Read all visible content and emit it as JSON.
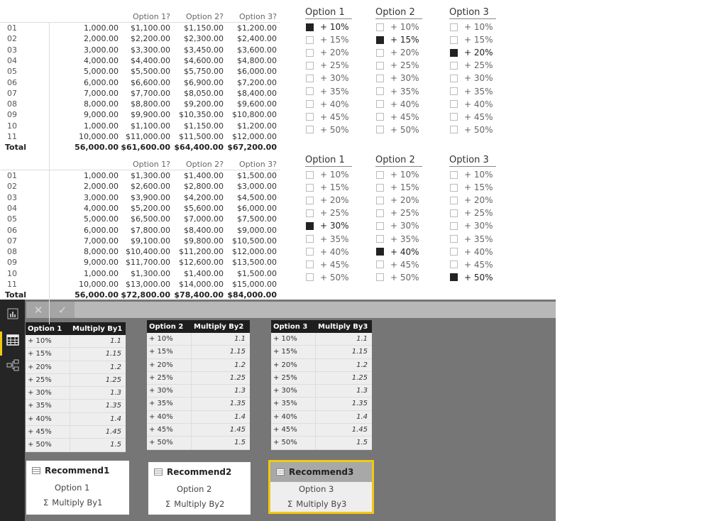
{
  "matrices": [
    {
      "headers": [
        "Option 1?",
        "Option 2?",
        "Option 3?"
      ],
      "rows": [
        [
          "01",
          "1,000.00",
          "$1,100.00",
          "$1,150.00",
          "$1,200.00"
        ],
        [
          "02",
          "2,000.00",
          "$2,200.00",
          "$2,300.00",
          "$2,400.00"
        ],
        [
          "03",
          "3,000.00",
          "$3,300.00",
          "$3,450.00",
          "$3,600.00"
        ],
        [
          "04",
          "4,000.00",
          "$4,400.00",
          "$4,600.00",
          "$4,800.00"
        ],
        [
          "05",
          "5,000.00",
          "$5,500.00",
          "$5,750.00",
          "$6,000.00"
        ],
        [
          "06",
          "6,000.00",
          "$6,600.00",
          "$6,900.00",
          "$7,200.00"
        ],
        [
          "07",
          "7,000.00",
          "$7,700.00",
          "$8,050.00",
          "$8,400.00"
        ],
        [
          "08",
          "8,000.00",
          "$8,800.00",
          "$9,200.00",
          "$9,600.00"
        ],
        [
          "09",
          "9,000.00",
          "$9,900.00",
          "$10,350.00",
          "$10,800.00"
        ],
        [
          "10",
          "1,000.00",
          "$1,100.00",
          "$1,150.00",
          "$1,200.00"
        ],
        [
          "11",
          "10,000.00",
          "$11,000.00",
          "$11,500.00",
          "$12,000.00"
        ]
      ],
      "total": [
        "Total",
        "56,000.00",
        "$61,600.00",
        "$64,400.00",
        "$67,200.00"
      ]
    },
    {
      "headers": [
        "Option 1?",
        "Option 2?",
        "Option 3?"
      ],
      "rows": [
        [
          "01",
          "1,000.00",
          "$1,300.00",
          "$1,400.00",
          "$1,500.00"
        ],
        [
          "02",
          "2,000.00",
          "$2,600.00",
          "$2,800.00",
          "$3,000.00"
        ],
        [
          "03",
          "3,000.00",
          "$3,900.00",
          "$4,200.00",
          "$4,500.00"
        ],
        [
          "04",
          "4,000.00",
          "$5,200.00",
          "$5,600.00",
          "$6,000.00"
        ],
        [
          "05",
          "5,000.00",
          "$6,500.00",
          "$7,000.00",
          "$7,500.00"
        ],
        [
          "06",
          "6,000.00",
          "$7,800.00",
          "$8,400.00",
          "$9,000.00"
        ],
        [
          "07",
          "7,000.00",
          "$9,100.00",
          "$9,800.00",
          "$10,500.00"
        ],
        [
          "08",
          "8,000.00",
          "$10,400.00",
          "$11,200.00",
          "$12,000.00"
        ],
        [
          "09",
          "9,000.00",
          "$11,700.00",
          "$12,600.00",
          "$13,500.00"
        ],
        [
          "10",
          "1,000.00",
          "$1,300.00",
          "$1,400.00",
          "$1,500.00"
        ],
        [
          "11",
          "10,000.00",
          "$13,000.00",
          "$14,000.00",
          "$15,000.00"
        ]
      ],
      "total": [
        "Total",
        "56,000.00",
        "$72,800.00",
        "$78,400.00",
        "$84,000.00"
      ]
    }
  ],
  "slicer_items": [
    "+ 10%",
    "+ 15%",
    "+ 20%",
    "+ 25%",
    "+ 30%",
    "+ 35%",
    "+ 40%",
    "+ 45%",
    "+ 50%"
  ],
  "slicers": [
    [
      {
        "title": "Option 1",
        "selected": "+ 10%"
      },
      {
        "title": "Option 2",
        "selected": "+ 15%"
      },
      {
        "title": "Option 3",
        "selected": "+ 20%"
      }
    ],
    [
      {
        "title": "Option 1",
        "selected": "+ 30%"
      },
      {
        "title": "Option 2",
        "selected": "+ 40%"
      },
      {
        "title": "Option 3",
        "selected": "+ 50%"
      }
    ]
  ],
  "toolbar": {
    "cancel": "✕",
    "commit": "✓"
  },
  "sidebar": {
    "icons": [
      "report-view-icon",
      "data-view-icon",
      "relationships-view-icon"
    ],
    "accent": "#f2c811"
  },
  "data_tables": [
    {
      "headers": [
        "Option 1",
        "Multiply By1"
      ],
      "rows": [
        [
          "+ 10%",
          "1.1"
        ],
        [
          "+ 15%",
          "1.15"
        ],
        [
          "+ 20%",
          "1.2"
        ],
        [
          "+ 25%",
          "1.25"
        ],
        [
          "+ 30%",
          "1.3"
        ],
        [
          "+ 35%",
          "1.35"
        ],
        [
          "+ 40%",
          "1.4"
        ],
        [
          "+ 45%",
          "1.45"
        ],
        [
          "+ 50%",
          "1.5"
        ]
      ]
    },
    {
      "headers": [
        "Option 2",
        "Multiply By2"
      ],
      "rows": [
        [
          "+ 10%",
          "1.1"
        ],
        [
          "+ 15%",
          "1.15"
        ],
        [
          "+ 20%",
          "1.2"
        ],
        [
          "+ 25%",
          "1.25"
        ],
        [
          "+ 30%",
          "1.3"
        ],
        [
          "+ 35%",
          "1.35"
        ],
        [
          "+ 40%",
          "1.4"
        ],
        [
          "+ 45%",
          "1.45"
        ],
        [
          "+ 50%",
          "1.5"
        ]
      ]
    },
    {
      "headers": [
        "Option 3",
        "Multiply By3"
      ],
      "rows": [
        [
          "+ 10%",
          "1.1"
        ],
        [
          "+ 15%",
          "1.15"
        ],
        [
          "+ 20%",
          "1.2"
        ],
        [
          "+ 25%",
          "1.25"
        ],
        [
          "+ 30%",
          "1.3"
        ],
        [
          "+ 35%",
          "1.35"
        ],
        [
          "+ 40%",
          "1.4"
        ],
        [
          "+ 45%",
          "1.45"
        ],
        [
          "+ 50%",
          "1.5"
        ]
      ]
    }
  ],
  "cards": [
    {
      "title": "Recommend1",
      "field": "Option 1",
      "measure": "Multiply By1",
      "sigma": "Σ"
    },
    {
      "title": "Recommend2",
      "field": "Option 2",
      "measure": "Multiply By2",
      "sigma": "Σ"
    },
    {
      "title": "Recommend3",
      "field": "Option 3",
      "measure": "Multiply By3",
      "sigma": "Σ",
      "active": true
    }
  ]
}
